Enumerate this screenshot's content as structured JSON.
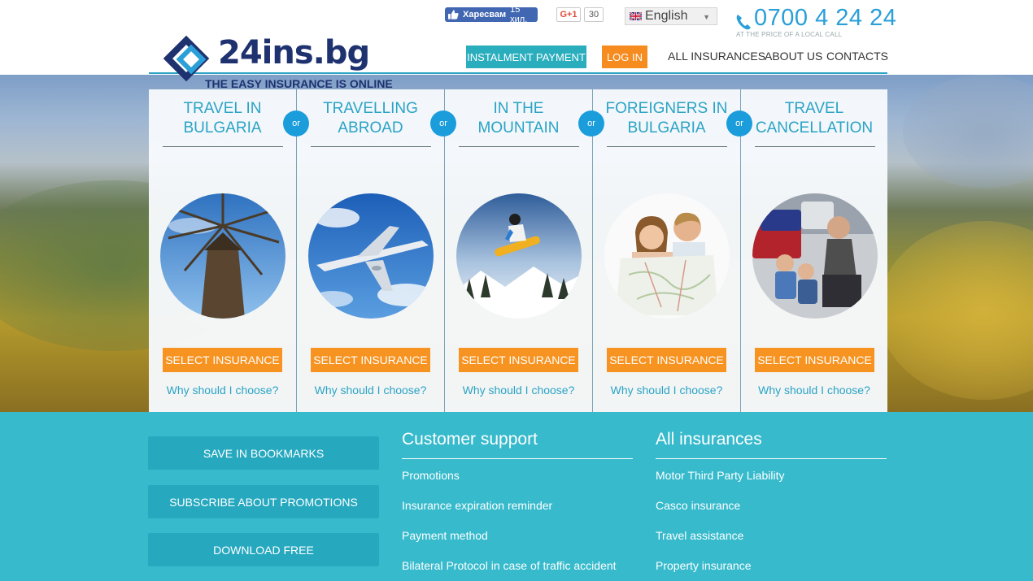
{
  "header": {
    "logo_text": "24ins.bg",
    "tagline": "THE EASY INSURANCE IS ONLINE",
    "fb_like_label": "Харесвам",
    "fb_like_count": "15 хил.",
    "gplus_label": "G+1",
    "gplus_count": "30",
    "language": "English",
    "phone": "0700 4 24 24",
    "phone_note": "AT THE PRICE OF A LOCAL CALL",
    "instalment_button": "INSTALMENT PAYMENT",
    "login_button": "LOG IN",
    "nav": [
      "ALL INSURANCES",
      "ABOUT US",
      "CONTACTS"
    ]
  },
  "hero": {
    "or_label": "or",
    "panels": [
      {
        "title_line1": "TRAVEL IN",
        "title_line2": "BULGARIA",
        "button": "SELECT INSURANCE",
        "link": "Why should I choose?"
      },
      {
        "title_line1": "TRAVELLING",
        "title_line2": "ABROAD",
        "button": "SELECT INSURANCE",
        "link": "Why should I choose?"
      },
      {
        "title_line1": "IN THE",
        "title_line2": "MOUNTAIN",
        "button": "SELECT INSURANCE",
        "link": "Why should I choose?"
      },
      {
        "title_line1": "FOREIGNERS IN",
        "title_line2": "BULGARIA",
        "button": "SELECT INSURANCE",
        "link": "Why should I choose?"
      },
      {
        "title_line1": "TRAVEL",
        "title_line2": "CANCELLATION",
        "button": "SELECT INSURANCE",
        "link": "Why should I choose?"
      }
    ]
  },
  "footer": {
    "buttons": [
      "SAVE IN BOOKMARKS",
      "SUBSCRIBE ABOUT PROMOTIONS",
      "DOWNLOAD FREE"
    ],
    "support": {
      "heading": "Customer support",
      "links": [
        "Promotions",
        "Insurance expiration reminder",
        "Payment method",
        "Bilateral Protocol in case of traffic accident"
      ]
    },
    "insurances": {
      "heading": "All insurances",
      "links": [
        "Motor Third Party Liability",
        "Casco insurance",
        "Travel assistance",
        "Property insurance"
      ]
    }
  },
  "colors": {
    "accent_teal": "#2aa3c5",
    "orange": "#f79320",
    "footer_bg": "#36bacc",
    "brand_navy": "#1f3270"
  }
}
